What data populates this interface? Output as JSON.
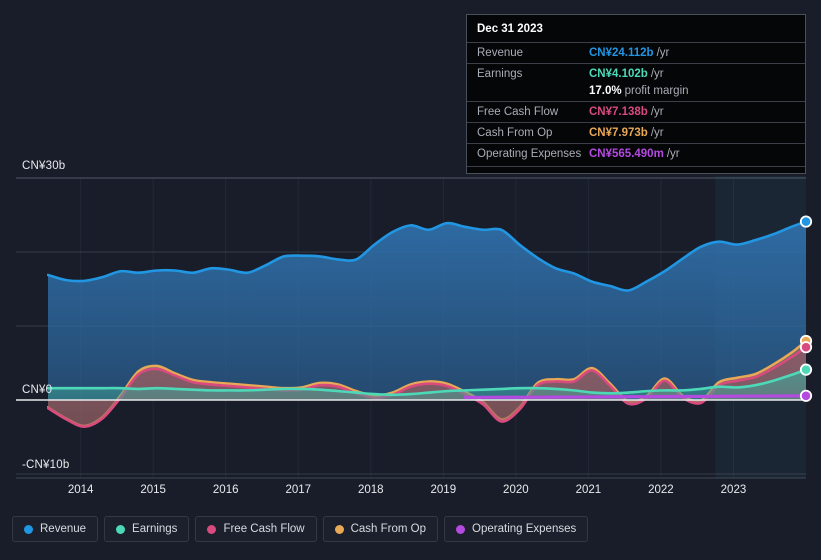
{
  "tooltip": {
    "date": "Dec 31 2023",
    "rows": [
      {
        "key": "Revenue",
        "value": "CN¥24.112b",
        "unit": "/yr",
        "color": "#2196e3"
      },
      {
        "key": "Earnings",
        "value": "CN¥4.102b",
        "unit": "/yr",
        "color": "#4dd9b8"
      },
      {
        "key": "",
        "value": "17.0%",
        "unit": "profit margin",
        "color": "#ffffff"
      },
      {
        "key": "Free Cash Flow",
        "value": "CN¥7.138b",
        "unit": "/yr",
        "color": "#d94a7e"
      },
      {
        "key": "Cash From Op",
        "value": "CN¥7.973b",
        "unit": "/yr",
        "color": "#e8a855"
      },
      {
        "key": "Operating Expenses",
        "value": "CN¥565.490m",
        "unit": "/yr",
        "color": "#b44ae0"
      }
    ]
  },
  "legend": [
    {
      "label": "Revenue",
      "color": "#2196e3"
    },
    {
      "label": "Earnings",
      "color": "#4dd9b8"
    },
    {
      "label": "Free Cash Flow",
      "color": "#d94a7e"
    },
    {
      "label": "Cash From Op",
      "color": "#e8a855"
    },
    {
      "label": "Operating Expenses",
      "color": "#b44ae0"
    }
  ],
  "chart_data": {
    "type": "area",
    "title": "",
    "xlabel": "",
    "ylabel": "",
    "currency": "CN¥",
    "units": "billions",
    "ylim": [
      -10,
      30
    ],
    "y_ticks": [
      30,
      0,
      -10
    ],
    "y_tick_labels": [
      "CN¥30b",
      "CN¥0",
      "-CN¥10b"
    ],
    "gridlines": [
      30,
      20,
      10,
      0,
      -10
    ],
    "grid": true,
    "legend_position": "bottom",
    "x_tick_labels": [
      "2014",
      "2015",
      "2016",
      "2017",
      "2018",
      "2019",
      "2020",
      "2021",
      "2022",
      "2023"
    ],
    "x_tick_values": [
      2014,
      2015,
      2016,
      2017,
      2018,
      2019,
      2020,
      2021,
      2022,
      2023
    ],
    "x_range": [
      2013.55,
      2024.0
    ],
    "highlight_band": {
      "from": 2022.75,
      "to": 2024.0
    },
    "series": [
      {
        "name": "Revenue",
        "color": "#2196e3",
        "fill": "#1d3b5c",
        "x": [
          2013.55,
          2013.8,
          2014.05,
          2014.3,
          2014.55,
          2014.8,
          2015.05,
          2015.3,
          2015.55,
          2015.8,
          2016.05,
          2016.3,
          2016.55,
          2016.8,
          2017.05,
          2017.3,
          2017.55,
          2017.8,
          2018.05,
          2018.3,
          2018.55,
          2018.8,
          2019.05,
          2019.3,
          2019.55,
          2019.8,
          2020.05,
          2020.3,
          2020.55,
          2020.8,
          2021.05,
          2021.3,
          2021.55,
          2021.8,
          2022.05,
          2022.3,
          2022.55,
          2022.8,
          2023.05,
          2023.3,
          2023.55,
          2023.8,
          2024.0
        ],
        "values": [
          16.9,
          16.2,
          16.1,
          16.6,
          17.4,
          17.2,
          17.5,
          17.5,
          17.2,
          17.8,
          17.6,
          17.2,
          18.2,
          19.4,
          19.5,
          19.4,
          19.0,
          19.0,
          21.0,
          22.7,
          23.6,
          23.0,
          23.9,
          23.4,
          23.0,
          23.0,
          21.0,
          19.2,
          17.8,
          17.1,
          16.0,
          15.4,
          14.8,
          16.0,
          17.4,
          19.1,
          20.7,
          21.4,
          21.0,
          21.6,
          22.4,
          23.4,
          24.112
        ]
      },
      {
        "name": "Earnings",
        "color": "#4dd9b8",
        "fill": "#2e7a72",
        "x": [
          2013.55,
          2013.8,
          2014.05,
          2014.3,
          2014.55,
          2014.8,
          2015.05,
          2015.3,
          2015.55,
          2015.8,
          2016.05,
          2016.3,
          2016.55,
          2016.8,
          2017.05,
          2017.3,
          2017.55,
          2017.8,
          2018.05,
          2018.3,
          2018.55,
          2018.8,
          2019.05,
          2019.3,
          2019.55,
          2019.8,
          2020.05,
          2020.3,
          2020.55,
          2020.8,
          2021.05,
          2021.3,
          2021.55,
          2021.8,
          2022.05,
          2022.3,
          2022.55,
          2022.8,
          2023.05,
          2023.3,
          2023.55,
          2023.8,
          2024.0
        ],
        "values": [
          1.6,
          1.6,
          1.6,
          1.6,
          1.6,
          1.5,
          1.6,
          1.5,
          1.4,
          1.3,
          1.3,
          1.3,
          1.4,
          1.5,
          1.5,
          1.4,
          1.2,
          1.0,
          0.8,
          0.7,
          0.8,
          1.0,
          1.2,
          1.3,
          1.4,
          1.5,
          1.6,
          1.6,
          1.5,
          1.3,
          1.0,
          0.9,
          1.0,
          1.2,
          1.3,
          1.3,
          1.5,
          1.8,
          1.7,
          2.0,
          2.6,
          3.4,
          4.102
        ]
      },
      {
        "name": "Free Cash Flow",
        "color": "#d94a7e",
        "fill": "#6d3a46",
        "x": [
          2013.55,
          2013.8,
          2014.05,
          2014.3,
          2014.55,
          2014.8,
          2015.05,
          2015.3,
          2015.55,
          2015.8,
          2016.05,
          2016.3,
          2016.55,
          2016.8,
          2017.05,
          2017.3,
          2017.55,
          2017.8,
          2018.05,
          2018.3,
          2018.55,
          2018.8,
          2019.05,
          2019.3,
          2019.55,
          2019.8,
          2020.05,
          2020.3,
          2020.55,
          2020.8,
          2021.05,
          2021.3,
          2021.55,
          2021.8,
          2022.05,
          2022.3,
          2022.55,
          2022.8,
          2023.05,
          2023.3,
          2023.55,
          2023.8,
          2024.0
        ],
        "values": [
          -1.1,
          -2.6,
          -3.6,
          -2.5,
          0.3,
          3.5,
          4.2,
          3.3,
          2.4,
          2.1,
          1.9,
          1.7,
          1.5,
          1.3,
          1.4,
          2.0,
          1.8,
          0.9,
          0.3,
          0.7,
          1.8,
          2.2,
          1.9,
          0.8,
          -0.6,
          -2.9,
          -1.3,
          2.0,
          2.5,
          2.5,
          4.0,
          1.9,
          -0.5,
          0.2,
          2.6,
          0.3,
          -0.4,
          2.0,
          2.6,
          3.1,
          4.3,
          5.8,
          7.138
        ]
      },
      {
        "name": "Cash From Op",
        "color": "#e8a855",
        "fill": "#6b5f46",
        "x": [
          2013.55,
          2013.8,
          2014.05,
          2014.3,
          2014.55,
          2014.8,
          2015.05,
          2015.3,
          2015.55,
          2015.8,
          2016.05,
          2016.3,
          2016.55,
          2016.8,
          2017.05,
          2017.3,
          2017.55,
          2017.8,
          2018.05,
          2018.3,
          2018.55,
          2018.8,
          2019.05,
          2019.3,
          2019.55,
          2019.8,
          2020.05,
          2020.3,
          2020.55,
          2020.8,
          2021.05,
          2021.3,
          2021.55,
          2021.8,
          2022.05,
          2022.3,
          2022.55,
          2022.8,
          2023.05,
          2023.3,
          2023.55,
          2023.8,
          2024.0
        ],
        "values": [
          -1.0,
          -2.5,
          -3.5,
          -2.3,
          0.6,
          3.9,
          4.6,
          3.6,
          2.7,
          2.4,
          2.2,
          2.0,
          1.8,
          1.6,
          1.7,
          2.3,
          2.1,
          1.2,
          0.6,
          1.0,
          2.1,
          2.5,
          2.2,
          1.1,
          -0.3,
          -2.6,
          -1.0,
          2.3,
          2.8,
          2.8,
          4.3,
          2.2,
          -0.2,
          0.5,
          2.9,
          0.6,
          -0.1,
          2.4,
          3.0,
          3.5,
          4.8,
          6.4,
          7.973
        ]
      },
      {
        "name": "Operating Expenses",
        "color": "#b44ae0",
        "fill": "none",
        "x": [
          2019.3,
          2019.8,
          2020.3,
          2020.8,
          2021.3,
          2021.8,
          2022.3,
          2022.8,
          2023.3,
          2024.0
        ],
        "values": [
          0.36,
          0.37,
          0.38,
          0.4,
          0.43,
          0.45,
          0.47,
          0.5,
          0.53,
          0.565
        ]
      }
    ]
  }
}
